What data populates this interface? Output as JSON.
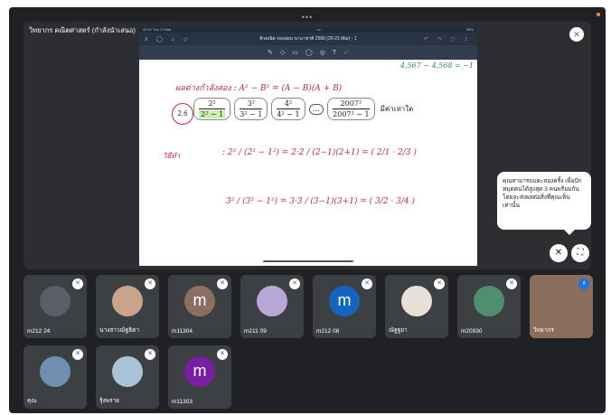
{
  "window": {
    "dots": "•••"
  },
  "presenter": {
    "name": "วิทยากร คณิตศาสตร์ (กำลังนำเสนอ)",
    "mic_icon": "mic-off-icon"
  },
  "slide": {
    "statusbar_left": "20:21  Tue 21 Mar",
    "statusbar_center": "•••",
    "statusbar_right": "96%",
    "title": "ติวคณิต รอบสอบ นานาชาติ 2566 (20-21 Mar) - 1",
    "note_top": "4,567 − 4,568 = −1",
    "line1": "ผลต่างกำลังสอง :  A² − B² = (A − B)(A + B)",
    "problem_number": "2.6",
    "fractions": [
      {
        "num": "2²",
        "den": "2² − 1"
      },
      {
        "num": "3²",
        "den": "3² − 1"
      },
      {
        "num": "4²",
        "den": "4² − 1"
      },
      {
        "num": "2007²",
        "den": "2007² − 1"
      }
    ],
    "ellipsis": "...",
    "problem_suffix": "มีค่าเท่าใด",
    "solve_label": "วิธีทำ",
    "line2": ":   2² / (2² − 1²)  =  2·2 / (2−1)(2+1)  =  ( 2/1 · 2/3 )",
    "line3": "3² / (3² − 1²)  =  3·3 / (3−1)(3+1)  =  ( 3/2 · 3/4 )"
  },
  "tooltip": {
    "text": "คุณสามารถแตะสองครั้ง เพื่อปักหมุดคนได้สูงสุด 3 คนพร้อมกัน โดยจะส่งผลต่อสิ่งที่คุณเห็นเท่านั้น"
  },
  "controls": {
    "pin_icon": "pin-off-icon",
    "fullscreen_icon": "fullscreen-icon"
  },
  "participants": [
    {
      "name": "m212 24",
      "type": "photo",
      "color": "#5a5f66"
    },
    {
      "name": "นางสาวณัฐธิดา",
      "type": "photo",
      "color": "#c9a48a"
    },
    {
      "name": "m11304",
      "type": "letter",
      "letter": "m",
      "color": "#8d6e63"
    },
    {
      "name": "m211 09",
      "type": "photo",
      "color": "#b7a8d6"
    },
    {
      "name": "m212 08",
      "type": "letter",
      "letter": "m",
      "color": "#1565c0"
    },
    {
      "name": "ณัฐฐยา",
      "type": "photo",
      "color": "#e6e0d8"
    },
    {
      "name": "m20930",
      "type": "photo",
      "color": "#4f8f6f"
    },
    {
      "name": "วิทยากร",
      "type": "speaking",
      "color": "#8a6d5a"
    },
    {
      "name": "คุณ",
      "type": "photo",
      "color": "#6f8fb0"
    },
    {
      "name": "รุ้งพราย",
      "type": "photo",
      "color": "#a9c4d8"
    },
    {
      "name": "m11303",
      "type": "letter",
      "letter": "m",
      "color": "#7b1fa2"
    }
  ]
}
